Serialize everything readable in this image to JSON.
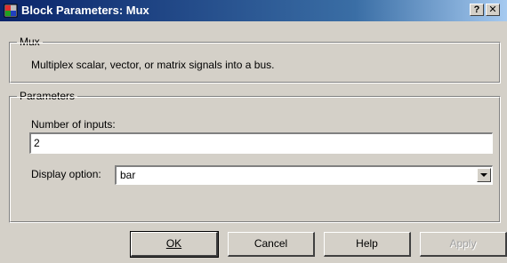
{
  "window": {
    "title": "Block Parameters: Mux",
    "help_label": "?",
    "close_label": "x"
  },
  "mux_group": {
    "legend": "Mux",
    "description": "Multiplex scalar, vector, or matrix signals into a bus."
  },
  "params_group": {
    "legend": "Parameters",
    "num_inputs_label": "Number of inputs:",
    "num_inputs_value": "2",
    "display_option_label": "Display option:",
    "display_option_value": "bar"
  },
  "buttons": {
    "ok": "OK",
    "cancel": "Cancel",
    "help": "Help",
    "apply": "Apply"
  },
  "colors": {
    "title_bar_start": "#0a246a",
    "title_bar_end": "#a6caf0",
    "face": "#d4d0c8"
  }
}
